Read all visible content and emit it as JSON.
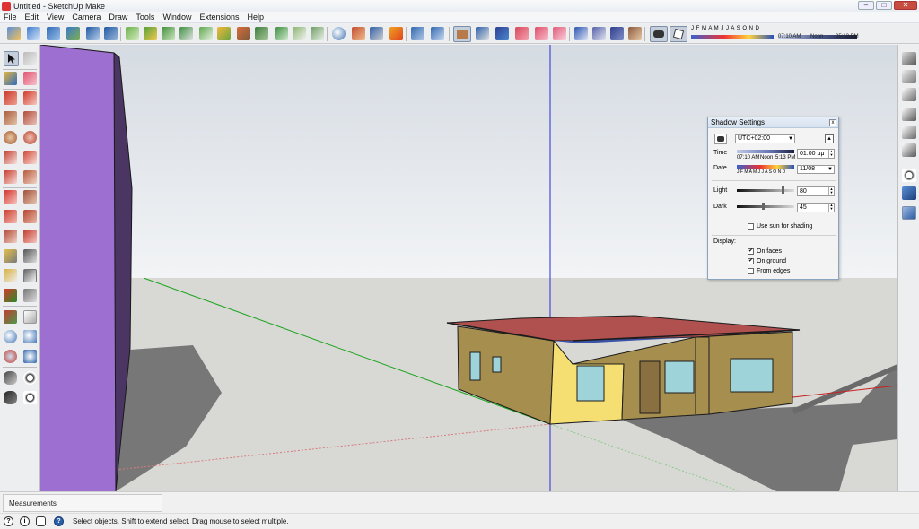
{
  "window": {
    "title": "Untitled - SketchUp Make",
    "minimize": "–",
    "maximize": "□",
    "close": "✕"
  },
  "menu": [
    "File",
    "Edit",
    "View",
    "Camera",
    "Draw",
    "Tools",
    "Window",
    "Extensions",
    "Help"
  ],
  "toolbar": {
    "months_label": "J F M A M J J A S O N D",
    "time_start": "07:10 AM",
    "time_noon": "Noon",
    "time_end": "05:13 PM"
  },
  "shadow_dialog": {
    "title": "Shadow Settings",
    "close": "x",
    "timezone": "UTC+02:00",
    "time_label": "Time",
    "time_start": "07:10 AM",
    "time_noon": "Noon",
    "time_end": "5:13 PM",
    "time_value": "01:00 μμ",
    "date_label": "Date",
    "months": "J F M A M J J A S O N D",
    "date_value": "11/08",
    "light_label": "Light",
    "light_value": "80",
    "light_level": 0.8,
    "dark_label": "Dark",
    "dark_value": "45",
    "dark_level": 0.45,
    "use_sun_label": "Use sun for shading",
    "use_sun_checked": false,
    "display_label": "Display:",
    "on_faces_label": "On faces",
    "on_faces_checked": true,
    "on_ground_label": "On ground",
    "on_ground_checked": true,
    "from_edges_label": "From edges",
    "from_edges_checked": false
  },
  "measurements_label": "Measurements",
  "status": {
    "text": "Select objects. Shift to extend select. Drag mouse to select multiple.",
    "icon_info": "i",
    "icon_help": "?",
    "icon_user": "?"
  },
  "colors": {
    "sky": "#e6eaee",
    "ground": "#d8d8d5",
    "wall_purple": "#9c6fd1",
    "wall_purple_dark": "#4a3563",
    "roof": "#b0504f",
    "house_wall": "#a68e4f",
    "house_wall_lit": "#f6df72",
    "window": "#9fd3da",
    "shadow": "#757575",
    "axis_blue": "#2a2ad6",
    "axis_green": "#1ea51e",
    "axis_red": "#c82020"
  }
}
